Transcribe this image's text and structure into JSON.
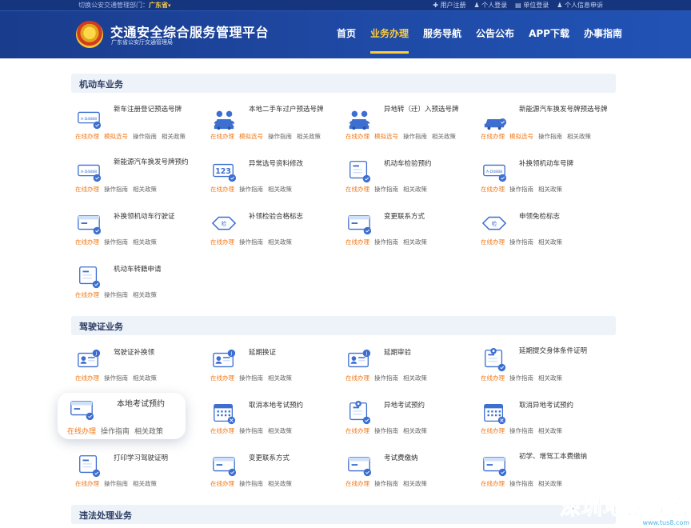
{
  "topbar": {
    "switch_label": "切换公安交通管理部门：",
    "current_dept": "广东省",
    "links": [
      "用户注册",
      "个人登录",
      "单位登录",
      "个人信息申诉"
    ]
  },
  "header": {
    "title": "交通安全综合服务管理平台",
    "subtitle": "广东省公安厅交通管理局",
    "nav": [
      "首页",
      "业务办理",
      "服务导航",
      "公告公布",
      "APP下载",
      "办事指南"
    ],
    "active_nav": "业务办理"
  },
  "sections": {
    "motor": "机动车业务",
    "license": "驾驶证业务",
    "violation": "违法处理业务"
  },
  "links": {
    "online": "在线办理",
    "mock": "模拟选号",
    "guide": "操作指南",
    "policy": "相关政策"
  },
  "motor_services": [
    "新车注册登记预选号牌",
    "本地二手车过户预选号牌",
    "异地转（迁）入预选号牌",
    "新能源汽车换发号牌预选号牌",
    "新能源汽车换发号牌预约",
    "异常选号资料修改",
    "机动车检验预约",
    "补换领机动车号牌",
    "补换领机动车行驶证",
    "补领检验合格标志",
    "变更联系方式",
    "申领免检标志",
    "机动车转籍申请"
  ],
  "license_services": [
    "驾驶证补换领",
    "延期换证",
    "延期审验",
    "延期提交身体条件证明",
    "本地考试预约",
    "取消本地考试预约",
    "异地考试预约",
    "取消异地考试预约",
    "打印学习驾驶证明",
    "变更联系方式",
    "考试费缴纳",
    "初学、增驾工本费缴纳"
  ],
  "watermark": {
    "big": "深圳地铁查询",
    "small": "www.tus8.com"
  },
  "colors": {
    "header_blue": "#1f4aa6",
    "accent_orange": "#f07a1a",
    "nav_active": "#ffcc33",
    "icon_blue": "#3d6fd1"
  }
}
